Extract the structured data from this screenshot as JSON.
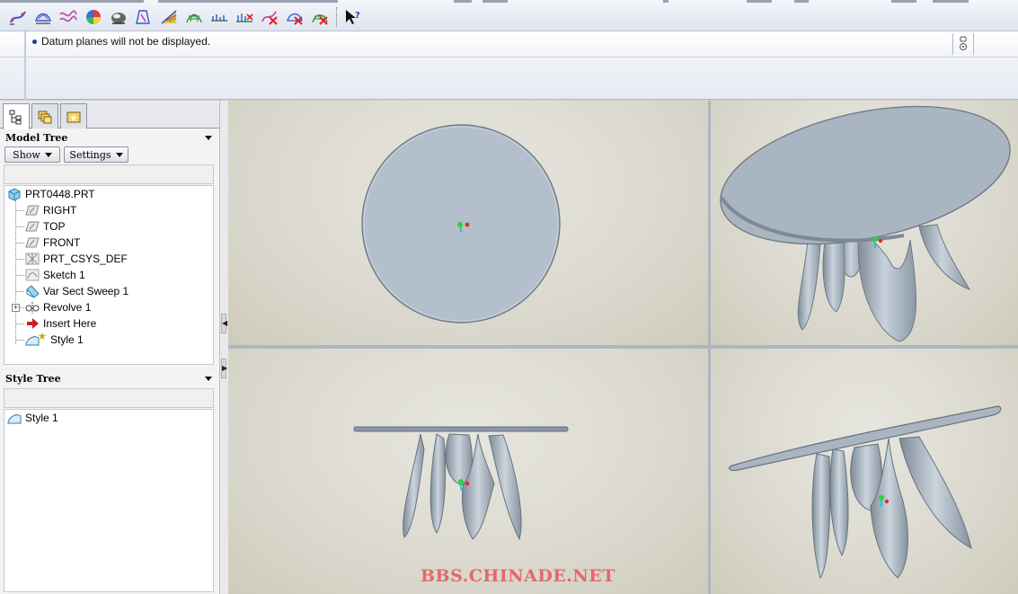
{
  "toolbar": {
    "icons": [
      "curve-icon",
      "surface-icon",
      "wave-curve-icon",
      "curvature-color-icon",
      "shading-icon",
      "draft-icon",
      "reflection-icon",
      "grid-surface-icon",
      "section-curve-icon",
      "offset-curve-icon",
      "delete-curve-icon",
      "delete-surface-icon",
      "delete-grid-icon",
      "whats-this-icon"
    ]
  },
  "message": {
    "text": "Datum planes will not be displayed."
  },
  "tabs": [
    "model-tree-tab",
    "layer-tree-tab",
    "favorites-tab"
  ],
  "model_tree": {
    "title": "Model Tree",
    "show_label": "Show",
    "settings_label": "Settings",
    "items": [
      {
        "label": "PRT0448.PRT",
        "icon": "part-icon"
      },
      {
        "label": "RIGHT",
        "icon": "datum-plane-icon"
      },
      {
        "label": "TOP",
        "icon": "datum-plane-icon"
      },
      {
        "label": "FRONT",
        "icon": "datum-plane-icon"
      },
      {
        "label": "PRT_CSYS_DEF",
        "icon": "csys-icon"
      },
      {
        "label": "Sketch 1",
        "icon": "sketch-icon"
      },
      {
        "label": "Var Sect Sweep 1",
        "icon": "sweep-icon"
      },
      {
        "label": "Revolve 1",
        "icon": "revolve-icon"
      },
      {
        "label": "Insert Here",
        "icon": "insert-arrow-icon"
      },
      {
        "label": "Style 1",
        "icon": "style-icon"
      }
    ]
  },
  "style_tree": {
    "title": "Style Tree",
    "items": [
      {
        "label": "Style 1",
        "icon": "style-icon"
      }
    ]
  },
  "watermark": "BBS.CHINADE.NET",
  "colors": {
    "surface": "#b4c0cb",
    "surface_dark": "#7f8c97",
    "viewport_bg": "#dcdad0",
    "watermark": "#e06b6b"
  }
}
